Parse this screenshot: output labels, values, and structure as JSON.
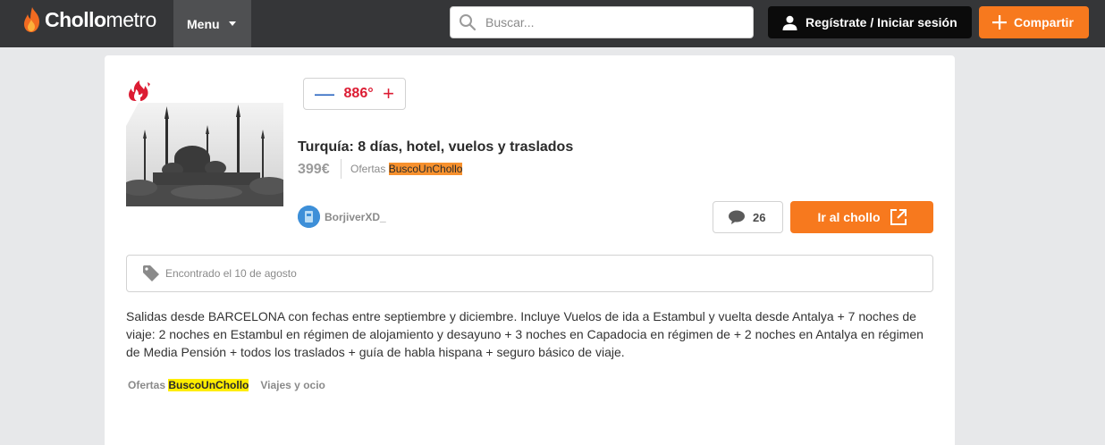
{
  "header": {
    "logo_bold": "Chollo",
    "logo_light": "metro",
    "menu_label": "Menu",
    "search_placeholder": "Buscar...",
    "login_label": "Regístrate / Iniciar sesión",
    "share_label": "Compartir"
  },
  "deal": {
    "temperature": "886°",
    "title": "Turquía: 8 días, hotel, vuelos y traslados",
    "price": "399€",
    "merchant_prefix": "Ofertas",
    "merchant_name": "BuscoUnChollo",
    "username": "BorjiverXD_",
    "comments_count": "26",
    "go_label": "Ir al chollo",
    "found_text": "Encontrado el 10 de agosto",
    "description": "Salidas desde BARCELONA con fechas entre septiembre y diciembre. Incluye Vuelos de ida a Estambul y vuelta desde Antalya + 7 noches de viaje: 2 noches en Estambul en régimen de alojamiento y desayuno + 3 noches en Capadocia en régimen de + 2 noches en Antalya en régimen de Media Pensión + todos los traslados + guía de habla hispana + seguro básico de viaje.",
    "footer": {
      "merchant_prefix": "Ofertas",
      "merchant_name": "BuscoUnChollo",
      "category": "Viajes y ocio"
    }
  },
  "colors": {
    "topbar": "#353638",
    "accent_orange": "#f7791e",
    "hot_red": "#dc1c33",
    "vote_blue": "#1d5cbd",
    "highlight_yellow": "#ffed00"
  },
  "icons": [
    "flame-logo-icon",
    "search-icon",
    "user-icon",
    "plus-icon",
    "fire-icon",
    "comment-icon",
    "external-link-icon",
    "tag-icon"
  ]
}
